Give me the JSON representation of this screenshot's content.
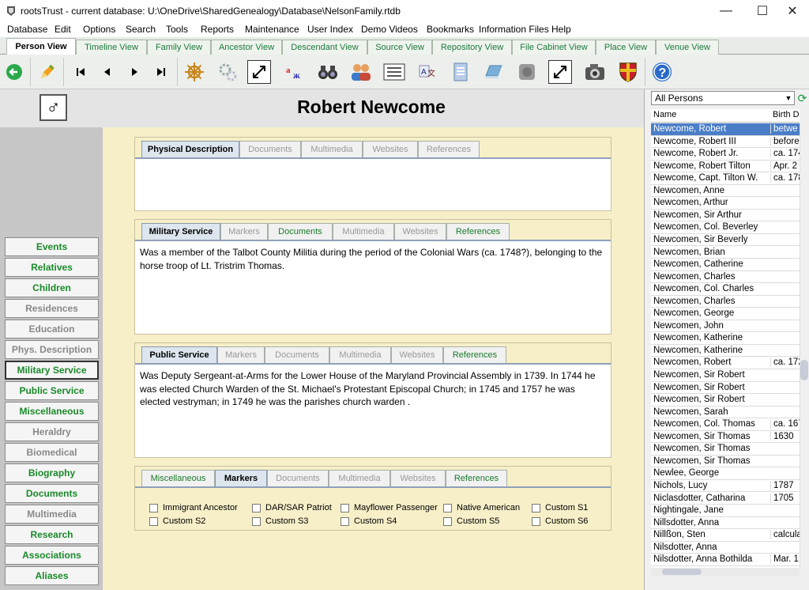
{
  "window": {
    "title": "rootsTrust - current database: U:\\OneDrive\\SharedGenealogy\\Database\\NelsonFamily.rtdb",
    "minimize": "—",
    "maximize": "☐",
    "close": "✕"
  },
  "menu": [
    "Database",
    "Edit",
    "Options",
    "Search",
    "Tools",
    "Reports",
    "Maintenance",
    "User Index",
    "Demo Videos",
    "Bookmarks",
    "Information Files",
    "Help"
  ],
  "view_tabs": [
    "Person View",
    "Timeline View",
    "Family View",
    "Ancestor View",
    "Descendant View",
    "Source View",
    "Repository View",
    "File Cabinet View",
    "Place View",
    "Venue View"
  ],
  "active_view_tab": "Person View",
  "toolbar_icons": [
    "back-icon",
    "edit-pencil-icon",
    "first-record-icon",
    "previous-record-icon",
    "next-record-icon",
    "last-record-icon",
    "ships-wheel-icon",
    "gears-icon",
    "expand-icon",
    "spellcheck-icon",
    "binoculars-icon",
    "people-icon",
    "list-view-icon",
    "translate-icon",
    "document-icon",
    "book-icon",
    "circle-icon",
    "fullscreen-icon",
    "camera-icon",
    "heraldry-shield-icon",
    "help-icon"
  ],
  "person": {
    "name": "Robert Newcome",
    "gender_symbol": "♂"
  },
  "left_nav": [
    {
      "label": "Events",
      "style": "green"
    },
    {
      "label": "Relatives",
      "style": "green"
    },
    {
      "label": "Children",
      "style": "green"
    },
    {
      "label": "Residences",
      "style": "gray"
    },
    {
      "label": "Education",
      "style": "gray"
    },
    {
      "label": "Phys. Description",
      "style": "gray"
    },
    {
      "label": "Military Service",
      "style": "green-selected"
    },
    {
      "label": "Public Service",
      "style": "green"
    },
    {
      "label": "Miscellaneous",
      "style": "green"
    },
    {
      "label": "Heraldry",
      "style": "gray"
    },
    {
      "label": "Biomedical",
      "style": "gray"
    },
    {
      "label": "Biography",
      "style": "green"
    },
    {
      "label": "Documents",
      "style": "green"
    },
    {
      "label": "Multimedia",
      "style": "gray"
    },
    {
      "label": "Research",
      "style": "green"
    },
    {
      "label": "Associations",
      "style": "green"
    },
    {
      "label": "Aliases",
      "style": "green"
    }
  ],
  "panels": {
    "physical": {
      "tabs": [
        "Physical Description",
        "Documents",
        "Multimedia",
        "Websites",
        "References"
      ],
      "text": ""
    },
    "military": {
      "tabs": [
        "Military Service",
        "Markers",
        "Documents",
        "Multimedia",
        "Websites",
        "References"
      ],
      "text": "Was a member of the Talbot County Militia during the period of the Colonial Wars (ca. 1748?), belonging to the horse troop of Lt. Tristrim Thomas."
    },
    "public": {
      "tabs": [
        "Public Service",
        "Markers",
        "Documents",
        "Multimedia",
        "Websites",
        "References"
      ],
      "text": "Was Deputy Sergeant-at-Arms for the Lower House of the Maryland Provincial Assembly in 1739. In 1744 he was elected Church Warden of the St. Michael's Protestant Episcopal Church; in 1745 and 1757 he was elected vestryman; in 1749 he was the parishes church warden ."
    },
    "misc": {
      "tabs": [
        "Miscellaneous",
        "Markers",
        "Documents",
        "Multimedia",
        "Websites",
        "References"
      ],
      "markers": [
        "Immigrant Ancestor",
        "DAR/SAR Patriot",
        "Mayflower Passenger",
        "Native American",
        "Custom S1",
        "Custom S2",
        "Custom S3",
        "Custom S4",
        "Custom S5",
        "Custom S6"
      ]
    }
  },
  "person_list": {
    "filter": "All Persons",
    "columns": [
      "Name",
      "Birth D"
    ],
    "rows": [
      [
        "Newcome, Robert",
        "betwe",
        true
      ],
      [
        "Newcome, Robert III",
        "before",
        false
      ],
      [
        "Newcome, Robert Jr.",
        "ca. 174",
        false
      ],
      [
        "Newcome, Robert Tilton",
        "Apr. 2",
        false
      ],
      [
        "Newcome, Capt. Tilton W.",
        "ca. 178",
        false
      ],
      [
        "Newcomen, Anne",
        "",
        false
      ],
      [
        "Newcomen, Arthur",
        "",
        false
      ],
      [
        "Newcomen, Sir Arthur",
        "",
        false
      ],
      [
        "Newcomen, Col. Beverley",
        "",
        false
      ],
      [
        "Newcomen, Sir Beverly",
        "",
        false
      ],
      [
        "Newcomen, Brian",
        "",
        false
      ],
      [
        "Newcomen, Catherine",
        "",
        false
      ],
      [
        "Newcomen, Charles",
        "",
        false
      ],
      [
        "Newcomen, Col. Charles",
        "",
        false
      ],
      [
        "Newcomen, Charles",
        "",
        false
      ],
      [
        "Newcomen, George",
        "",
        false
      ],
      [
        "Newcomen, John",
        "",
        false
      ],
      [
        "Newcomen, Katherine",
        "",
        false
      ],
      [
        "Newcomen, Katherine",
        "",
        false
      ],
      [
        "Newcomen, Robert",
        "ca. 172",
        false
      ],
      [
        "Newcomen, Sir Robert",
        "",
        false
      ],
      [
        "Newcomen, Sir Robert",
        "",
        false
      ],
      [
        "Newcomen, Sir Robert",
        "",
        false
      ],
      [
        "Newcomen, Sarah",
        "",
        false
      ],
      [
        "Newcomen, Col. Thomas",
        "ca. 167",
        false
      ],
      [
        "Newcomen, Sir Thomas",
        "1630",
        false
      ],
      [
        "Newcomen, Sir Thomas",
        "",
        false
      ],
      [
        "Newcomen, Sir Thomas",
        "",
        false
      ],
      [
        "Newlee, George",
        "",
        false
      ],
      [
        "Nichols, Lucy",
        "1787",
        false
      ],
      [
        "Niclasdotter, Catharina",
        "1705",
        false
      ],
      [
        "Nightingale, Jane",
        "",
        false
      ],
      [
        "Nillsdotter, Anna",
        "",
        false
      ],
      [
        "Nillßon, Sten",
        "calcula",
        false
      ],
      [
        "Nilsdotter, Anna",
        "",
        false
      ],
      [
        "Nilsdotter, Anna Bothilda",
        "Mar. 1",
        false
      ]
    ]
  }
}
